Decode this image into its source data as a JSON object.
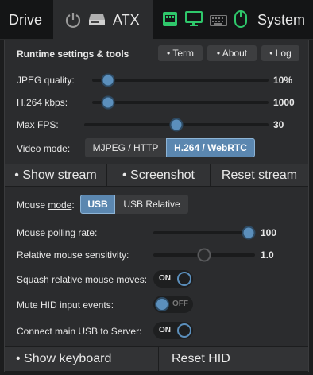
{
  "nav": {
    "drive": "Drive",
    "atx": "ATX",
    "system": "System",
    "icons": [
      "power-icon",
      "atx-box-icon",
      "ethernet-icon",
      "monitor-icon",
      "keyboard-icon",
      "mouse-icon"
    ],
    "accent": "#2fc86b"
  },
  "panel": {
    "title": "Runtime settings & tools",
    "tools": [
      "• Term",
      "• About",
      "• Log"
    ]
  },
  "sliders": {
    "jpeg": {
      "label": "JPEG quality:",
      "value": "10%",
      "fraction": 0.09
    },
    "h264": {
      "label": "H.264 kbps:",
      "value": "1000",
      "fraction": 0.09
    },
    "fps": {
      "label": "Max FPS:",
      "value": "30",
      "fraction": 0.5
    }
  },
  "video_mode": {
    "label_prefix": "Video ",
    "label_under": "mode",
    "label_suffix": ":",
    "options": [
      "MJPEG / HTTP",
      "H.264 / WebRTC"
    ],
    "selected": "H.264 / WebRTC"
  },
  "stream_bar": [
    "• Show stream",
    "• Screenshot",
    "Reset stream"
  ],
  "mouse_mode": {
    "label_prefix": "Mouse ",
    "label_under": "mode",
    "label_suffix": ":",
    "options": [
      "USB",
      "USB Relative"
    ],
    "selected": "USB"
  },
  "mouse_sliders": {
    "polling": {
      "label": "Mouse polling rate:",
      "value": "100",
      "fraction": 1.0
    },
    "sensitivity": {
      "label": "Relative mouse sensitivity:",
      "value": "1.0",
      "fraction": 0.5
    }
  },
  "toggles": {
    "squash": {
      "label": "Squash relative mouse moves:",
      "state": "ON"
    },
    "mute": {
      "label": "Mute HID input events:",
      "state": "OFF"
    },
    "connect": {
      "label": "Connect main USB to Server:",
      "state": "ON"
    }
  },
  "bottom_bar": [
    "• Show keyboard",
    "Reset HID"
  ],
  "colors": {
    "slider_thumb": "#5b8fbc",
    "active_segment": "#5b87b0"
  }
}
